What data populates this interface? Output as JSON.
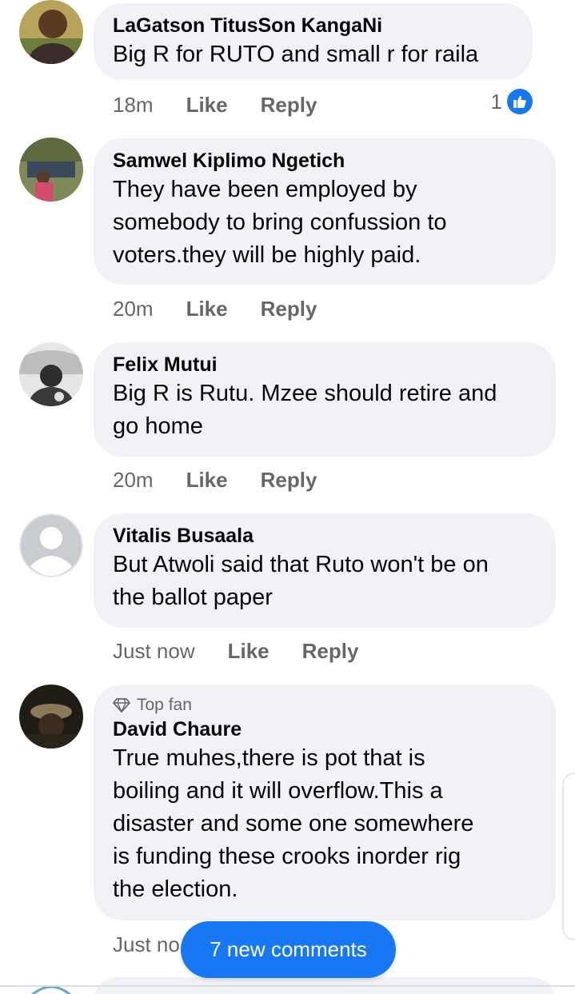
{
  "comments": [
    {
      "name": "LaGatson TitusSon KangaNi",
      "text": "Big R for RUTO and small r for raila",
      "time": "18m",
      "like": "Like",
      "reply": "Reply",
      "reaction_count": "1"
    },
    {
      "name": "Samwel Kiplimo Ngetich",
      "text": "They have been employed by\nsomebody to bring confussion to\nvoters.they will be highly paid.",
      "time": "20m",
      "like": "Like",
      "reply": "Reply"
    },
    {
      "name": "Felix Mutui",
      "text": "Big R is Rutu. Mzee should retire and\ngo home",
      "time": "20m",
      "like": "Like",
      "reply": "Reply"
    },
    {
      "name": "Vitalis Busaala",
      "text": "But Atwoli said that Ruto won't be on\nthe ballot paper",
      "time": "Just now",
      "like": "Like",
      "reply": "Reply"
    },
    {
      "badge": "Top fan",
      "name": "David Chaure",
      "text": "True muhes,there is pot that is\nboiling and it will overflow.This a\ndisaster and some one somewhere\nis funding these crooks inorder rig\nthe election.",
      "time": "Just no"
    }
  ],
  "new_comments_label": "7 new comments",
  "colors": {
    "accent": "#1877f2",
    "bubble": "#f0f2f5",
    "meta_text": "#65676b",
    "text": "#050505"
  }
}
